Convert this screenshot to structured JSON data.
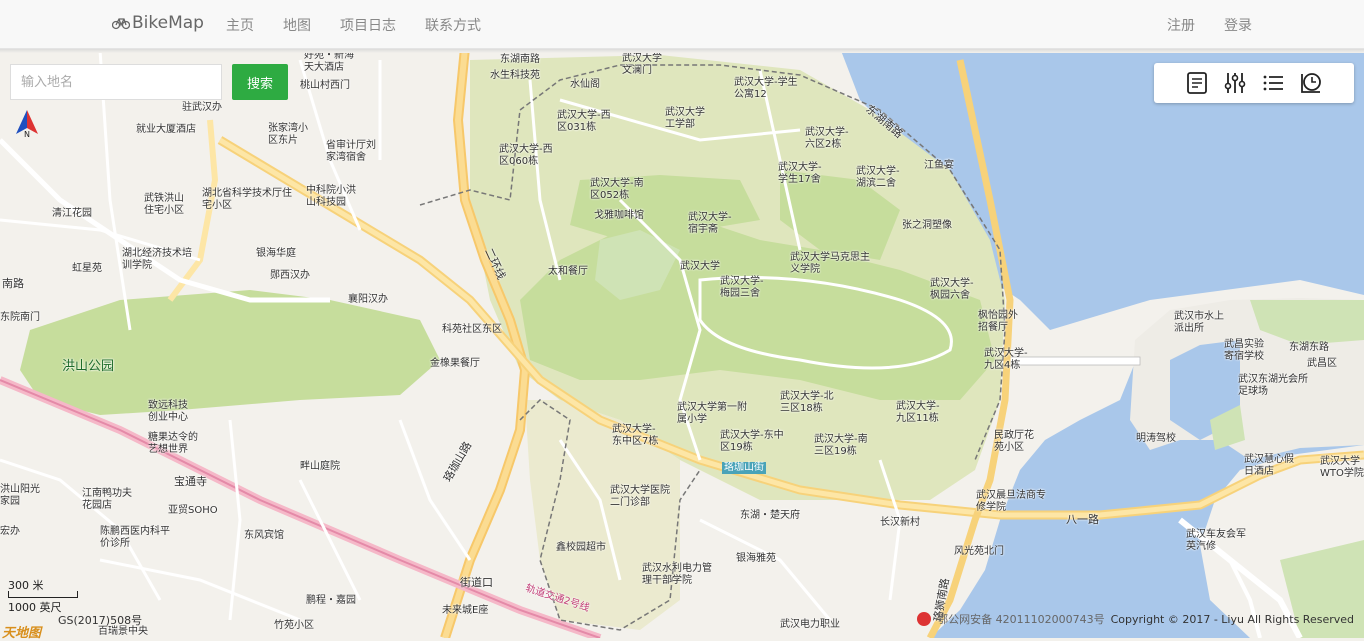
{
  "navbar": {
    "brand": "BikeMap",
    "links": [
      "主页",
      "地图",
      "项目日志",
      "联系方式"
    ],
    "right": [
      "注册",
      "登录"
    ]
  },
  "search": {
    "placeholder": "输入地名",
    "button": "搜索"
  },
  "toolbar": {
    "icons": [
      "document-icon",
      "sliders-icon",
      "list-icon",
      "history-clock-icon"
    ]
  },
  "map": {
    "scale_km": "300 米",
    "scale_ft": "1000 英尺",
    "approval": "GS(2017)508号",
    "logo": "天地图",
    "icp": "鄂公网安备 42011102000743号",
    "copyright": "Copyright © 2017 - Liyu All Rights Reserved",
    "labels": {
      "l1": "好苑・新海",
      "l2": "天大酒店",
      "l3": "桃山村西门",
      "l4": "东湖南路",
      "l5": "水生科技苑",
      "l6": "水仙阁",
      "l7": "武汉大学文澜门",
      "l8": "武汉大学-学生公寓12",
      "l9": "东湖南路",
      "l10": "武汉大学-西区031栋",
      "l11": "武汉大学工学部",
      "l12": "武汉大学-六区2栋",
      "l13": "武汉大学-西区060栋",
      "l14": "武汉大学-南区052栋",
      "l15": "武汉大学-学生17舍",
      "l16": "武汉大学-湖滨二舍",
      "l17": "江鱼宴",
      "l18": "戈雅咖啡馆",
      "l19": "武汉大学-宿宇斋",
      "l20": "张之洞塑像",
      "l21": "太和餐厅",
      "l22": "武汉大学",
      "l23": "武汉大学马克思主义学院",
      "l24": "武汉大学-梅园三舍",
      "l25": "武汉大学-枫园六舍",
      "l26": "枫怡园外招餐厅",
      "l27": "武汉大学-九区4栋",
      "l28": "武汉市水上派出所",
      "l29": "武昌实验寄宿学校",
      "l30": "东湖东路",
      "l31": "武昌区",
      "l32": "武汉东湖光会所足球场",
      "l33": "武汉大学-北三区18栋",
      "l34": "武汉大学-九区11栋",
      "l35": "武汉大学第一附属小学",
      "l36": "武汉大学-东中区7栋",
      "l37": "武汉大学-东中区19栋",
      "l38": "武汉大学-南三区19栋",
      "l39": "民政厅花苑小区",
      "l40": "明涛驾校",
      "l41": "珞珈山街",
      "l42": "武汉大学医院二门诊部",
      "l43": "武汉慧心假日酒店",
      "l44": "武汉大学WTO学院",
      "l45": "武汉晨旦法商专修学院",
      "l46": "八一路",
      "l47": "东湖・楚天府",
      "l48": "长汉新村",
      "l49": "鑫校园超市",
      "l50": "银海雅苑",
      "l51": "风光苑北门",
      "l52": "武汉车友会军英汽修",
      "l53": "武汉水利电力管理干部学院",
      "l54": "街道口",
      "l55": "轨道交通2号线",
      "l56": "未来城E座",
      "l57": "鹏程・嘉园",
      "l58": "竹苑小区",
      "l59": "武汉电力职业",
      "l60": "珞狮南路",
      "l61": "珞珈山路",
      "l62": "科苑社区东区",
      "l63": "金橡果餐厅",
      "l64": "洪山公园",
      "l65": "襄阳汉办",
      "l66": "郧西汉办",
      "l67": "银海华庭",
      "l68": "湖北经济技术培训学院",
      "l69": "虹星苑",
      "l70": "南路",
      "l71": "东院南门",
      "l72": "清江花园",
      "l73": "武铁洪山住宅小区",
      "l74": "湖北省科学技术厅住宅小区",
      "l75": "中科院小洪山科技园",
      "l76": "省审计厅刘家湾宿舍",
      "l77": "张家湾小区东片",
      "l78": "就业大厦酒店",
      "l79": "驻武汉办",
      "l80": "致远科技创业中心",
      "l81": "糖果达令的艺想世界",
      "l82": "宝通寺",
      "l83": "江南鸭功夫花园店",
      "l84": "亚贸SOHO",
      "l85": "陈鹏西医内科平价诊所",
      "l86": "东风宾馆",
      "l87": "畔山庭院",
      "l88": "二环线",
      "l89": "洪山阳光家园",
      "l90": "宏办",
      "l91": "百瑞景中央"
    }
  }
}
